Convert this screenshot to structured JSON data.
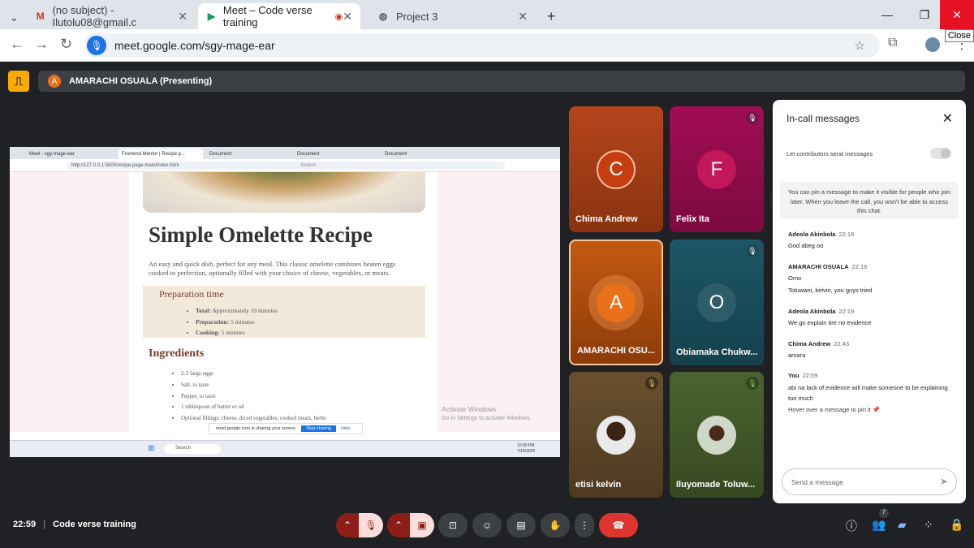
{
  "browser": {
    "tabs": [
      {
        "label": "(no subject) - Ilutolu08@gmail.c",
        "icon": "gmail-icon"
      },
      {
        "label": "Meet – Code verse training",
        "icon": "meet-icon"
      },
      {
        "label": "Project 3",
        "icon": "globe-icon"
      }
    ],
    "url": "meet.google.com/sgy-mage-ear",
    "tooltip": "Close"
  },
  "meet": {
    "presenting_label": "AMARACHI OSUALA (Presenting)",
    "presenter_initial": "A",
    "time": "22:59",
    "meeting_name": "Code verse training",
    "participants_count": "7"
  },
  "shared_screen": {
    "tabs": [
      "Meet - sgy-mage-ear",
      "Frontend Mentor | Recipe p...",
      "Document",
      "Document",
      "Document"
    ],
    "url": "http://127.0.0.1:5500/recipe-page-main/index.html",
    "search_placeholder": "Search",
    "recipe": {
      "title": "Simple Omelette Recipe",
      "description": "An easy and quick dish, perfect for any meal. This classic omelette combines beaten eggs cooked to perfection, optionally filled with your choice of cheese, vegetables, or meats.",
      "prep_heading": "Preparation time",
      "prep_items": [
        {
          "k": "Total:",
          "v": "Approximately 10 minutes"
        },
        {
          "k": "Preparation:",
          "v": "5 minutes"
        },
        {
          "k": "Cooking:",
          "v": "5 minutes"
        }
      ],
      "ingredients_heading": "Ingredients",
      "ingredients": [
        "2-3 large eggs",
        "Salt, to taste",
        "Pepper, to taste",
        "1 tablespoon of butter or oil",
        "Optional fillings: cheese, diced vegetables, cooked meats, herbs"
      ]
    },
    "watermark_title": "Activate Windows",
    "watermark_sub": "Go to Settings to activate Windows.",
    "share_notice": "meet.google.com is sharing your screen.",
    "stop_label": "Stop sharing",
    "hide_label": "Hide",
    "taskbar_search": "Search",
    "taskbar_time": "10:00 PM",
    "taskbar_date": "7/14/2025"
  },
  "participants": [
    {
      "name": "Chima Andrew",
      "initial": "C"
    },
    {
      "name": "Felix Ita",
      "initial": "F"
    },
    {
      "name": "AMARACHI OSU...",
      "initial": "A"
    },
    {
      "name": "Obiamaka Chukw...",
      "initial": "O"
    },
    {
      "name": "etisi kelvin",
      "initial": ""
    },
    {
      "name": "Iluyomade Toluw...",
      "initial": ""
    }
  ],
  "chat": {
    "title": "In-call messages",
    "toggle_label": "Let contributors send messages",
    "info": "You can pin a message to make it visible for people who join later. When you leave the call, you won't be able to access this chat.",
    "messages": [
      {
        "sender": "Adeola Akinbola",
        "time": "22:16",
        "lines": [
          "God abeg oo"
        ]
      },
      {
        "sender": "AMARACHI OSUALA",
        "time": "22:16",
        "lines": [
          "Omo",
          "Toluwani, kelvin, you guys tried"
        ]
      },
      {
        "sender": "Adeola Akinbola",
        "time": "22:19",
        "lines": [
          "We go explain tire no evidence"
        ]
      },
      {
        "sender": "Chima Andrew",
        "time": "22:43",
        "lines": [
          "amara"
        ]
      },
      {
        "sender": "You",
        "time": "22:59",
        "lines": [
          "abi na lack of evidence will make  someone to be explaining too much"
        ]
      }
    ],
    "pin_hint": "Hover over a message to pin it",
    "send_placeholder": "Send a message"
  }
}
